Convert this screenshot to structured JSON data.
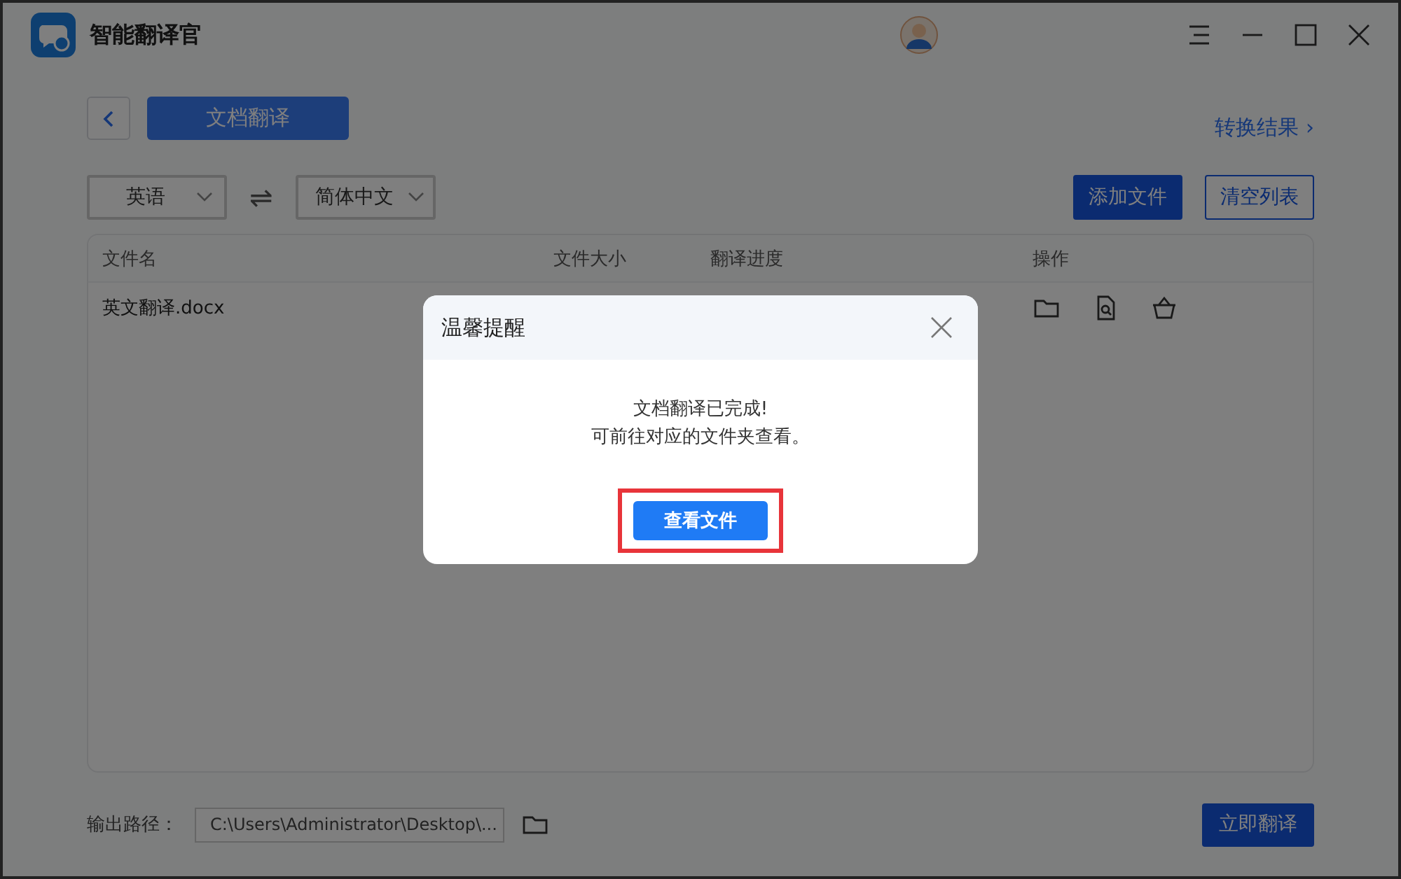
{
  "app": {
    "title": "智能翻译官"
  },
  "nav": {
    "tab": "文档翻译",
    "result_link": "转换结果 ›"
  },
  "languages": {
    "source": "英语",
    "target": "简体中文",
    "swap": "⇌"
  },
  "actions": [
    {
      "label": "添加文件",
      "kind": "primary"
    },
    {
      "label": "清空列表",
      "kind": "outline"
    }
  ],
  "table": {
    "columns": [
      "文件名",
      "文件大小",
      "翻译进度",
      "操作"
    ],
    "rows": [
      {
        "name": "英文翻译.docx"
      }
    ]
  },
  "footer": {
    "label": "输出路径：",
    "path": "C:\\Users\\Administrator\\Desktop\\...",
    "button": "立即翻译"
  },
  "dialog": {
    "title": "温馨提醒",
    "message": [
      "文档翻译已完成!",
      "可前往对应的文件夹查看。"
    ],
    "button": "查看文件",
    "highlighted": true
  }
}
